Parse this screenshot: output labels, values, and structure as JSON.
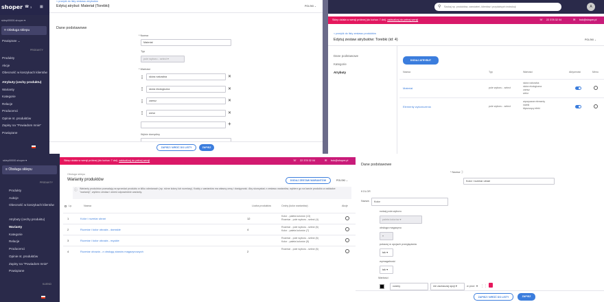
{
  "tl": {
    "brand": "shoper",
    "header_right": "3",
    "shop": "sklep00000.shoper",
    "main_btn": "Obsługa sklepu",
    "powiazane": "Powiązane",
    "section": "PRODUKTY",
    "nav": [
      "Produkty",
      "Akcje",
      "Obecność w koszykach klientów",
      "Atrybuty (cechy produktu)",
      "Warianty",
      "Kategorie",
      "Relacje",
      "Producenci",
      "Opinie nt. produktów",
      "Zapisy na \"Powiadom mnie\"",
      "Powiązane"
    ],
    "breadcrumb": "< przejdź do listy zestawu atrybutów",
    "title": "Edytuj atrybut: Materiał (Torebki)",
    "lang": "POLSKI",
    "section_title": "Dane podstawowe",
    "name_label": "* Nazwa",
    "name_value": "Materiał",
    "type_label": "Typ",
    "type_value": "pole wyboru - select",
    "values_label": "* Wartości",
    "values": [
      "skóra naturalna",
      "skóra ekologiczna",
      "zamsz",
      "welur"
    ],
    "default_label": "Wybór domyślny",
    "save_back": "ZAPISZ I WRÓĆ DO LISTY",
    "save": "ZAPISZ"
  },
  "tr": {
    "search_placeholder": "Szukaj np. produktów, zamówień, klientów i przydatnych instrukcji",
    "avatar": "A",
    "alert": "Sklep działa w wersji próbnej (do końca: 7 dni).",
    "alert_link": "zaktualizuj do pełnej wersji",
    "phone": "22 378 32 04",
    "email": "bok@shoper.pl",
    "breadcrumb": "< przejdź do listy zestawu produktów",
    "title": "Edytuj zestaw atrybutów: Torebki (id: 4)",
    "lang": "POLSKI",
    "tabs": [
      "Dane podstawowe",
      "Kategorie",
      "Atrybuty"
    ],
    "add_btn": "DODAJ ATRYBUT",
    "cols": [
      "Nazwa",
      "Typ",
      "Wartości",
      "Aktywność",
      "Menu"
    ],
    "rows": [
      {
        "name": "Materiał",
        "type": "pole wyboru - select",
        "values": [
          "skóra naturalna",
          "skóra ekologiczna",
          "zamsz",
          "welur"
        ]
      },
      {
        "name": "Elementy wykończenia",
        "type": "pole wyboru - select",
        "values": [
          "wyszywane elementy",
          "ćwieki",
          "błyszczący efekt"
        ]
      }
    ]
  },
  "bl": {
    "shop": "sklep00000.shoper",
    "main_btn": "Obsługa sklepu",
    "alert": "Sklep działa w wersji próbnej (do końca: 7 dni).",
    "alert_link": "zaktualizuj do pełnej wersji",
    "phone": "22 378 32 04",
    "email": "bok@shoper.pl",
    "section": "PRODUKTY",
    "nav": [
      "Produkty",
      "Aukcje",
      "Obecność w koszykach klientów",
      "Atrybuty (cechy produktu)",
      "Warianty",
      "Kategorie",
      "Relacje",
      "Producenci",
      "Opinie nt. produktów",
      "Zapisy na \"Powiadom mnie\"",
      "Powiązane"
    ],
    "section2": "KLIENCI",
    "breadcrumb": "Obsługa sklepu",
    "title": "Warianty produktów",
    "add_btn": "DODAJ ZESTAW WARIANTÓW",
    "lang": "POLSKI",
    "info": "Warianty produktów pozwalają na sprzedaż produktu w kilku odmianach (np. różne kolory lub rozmiary). Każdy z wariantów ma własną cenę i dostępność. Aby skorzystać z zestawu wariantów, wybierz go na karcie produktu w zakładce \"warianty\", wybierz zestaw i określ odpowiednie warianty.",
    "cols": [
      "Lp.",
      "Nazwa",
      "Liczba produktów",
      "Cechy (kolor wariantów)",
      "Akcje"
    ],
    "rows": [
      {
        "lp": "1",
        "name": "Kolor i rozmiar ubrań",
        "count": "12",
        "cechy": [
          "Kolor - paleta kolorów (13)",
          "Rozmiar - pole wyboru - select (4)"
        ]
      },
      {
        "lp": "2",
        "name": "Rozmiar i kolor obuwia - damskie",
        "count": "4",
        "cechy": [
          "Rozmiar - pole wyboru - select (6)",
          "Kolor - paleta kolorów (7)"
        ]
      },
      {
        "lp": "3",
        "name": "Rozmiar i kolor obuwia - męskie",
        "count": "",
        "cechy": [
          "Rozmiar - pole wyboru - select (6)",
          "Kolor - paleta kolorów (5)"
        ]
      },
      {
        "lp": "4",
        "name": "Rozmiar obuwia - z obsługą stanów magazynowych",
        "count": "2",
        "cechy": [
          "Rozmiar - pole wyboru - select (6)"
        ]
      }
    ]
  },
  "br": {
    "section_title": "Dane podstawowe",
    "name_label": "* Nazwa",
    "name_value": "Kolor i rozmiar ubrań",
    "group": "KOLOR",
    "field_label": "Nazwa",
    "field_value": "Kolor",
    "rodzaj_label": "rodzaj pola wyboru",
    "rodzaj_value": "paleta kolorów",
    "obsluga_label": "obsługa magazynu",
    "obsluga_value": "",
    "pokaz_label": "pokazuj w opcjach przeglądania",
    "pokaz_value": "tak",
    "wymagalnosc_label": "wymagalność",
    "wymagalnosc_value": "tak",
    "wartosci_label": "Wartości",
    "color_value": "czarny",
    "default_select": "nie zaznaczaj opcji",
    "prod_value": "w prod",
    "save_back": "ZAPISZ I WRÓĆ DO LISTY",
    "save": "ZAPISZ"
  }
}
